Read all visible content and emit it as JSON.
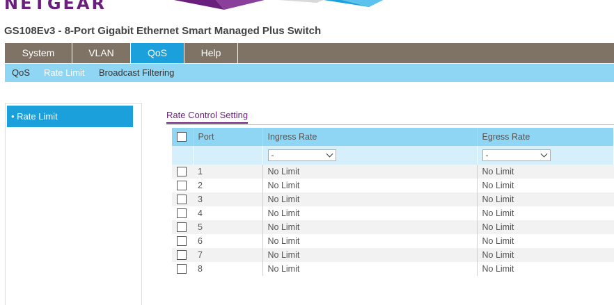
{
  "brand": {
    "logo_text": "NETGEAR"
  },
  "device_title": "GS108Ev3 - 8-Port Gigabit Ethernet Smart Managed Plus Switch",
  "main_nav": [
    {
      "label": "System",
      "active": false
    },
    {
      "label": "VLAN",
      "active": false
    },
    {
      "label": "QoS",
      "active": true
    },
    {
      "label": "Help",
      "active": false
    }
  ],
  "sub_nav": [
    {
      "label": "QoS",
      "active": false
    },
    {
      "label": "Rate Limit",
      "active": true
    },
    {
      "label": "Broadcast Filtering",
      "active": false
    }
  ],
  "left_menu": {
    "item": "• Rate Limit"
  },
  "section_title": "Rate Control Setting",
  "table": {
    "headers": {
      "port": "Port",
      "ingress": "Ingress Rate",
      "egress": "Egress Rate"
    },
    "filters": {
      "ingress": "-",
      "egress": "-"
    },
    "rows": [
      {
        "port": "1",
        "ingress": "No Limit",
        "egress": "No Limit"
      },
      {
        "port": "2",
        "ingress": "No Limit",
        "egress": "No Limit"
      },
      {
        "port": "3",
        "ingress": "No Limit",
        "egress": "No Limit"
      },
      {
        "port": "4",
        "ingress": "No Limit",
        "egress": "No Limit"
      },
      {
        "port": "5",
        "ingress": "No Limit",
        "egress": "No Limit"
      },
      {
        "port": "6",
        "ingress": "No Limit",
        "egress": "No Limit"
      },
      {
        "port": "7",
        "ingress": "No Limit",
        "egress": "No Limit"
      },
      {
        "port": "8",
        "ingress": "No Limit",
        "egress": "No Limit"
      }
    ]
  },
  "colors": {
    "brand_purple": "#6a1f7d",
    "nav_gray": "#7f7365",
    "active_blue": "#1ba0dc",
    "sub_nav_blue": "#8fd6f4"
  }
}
